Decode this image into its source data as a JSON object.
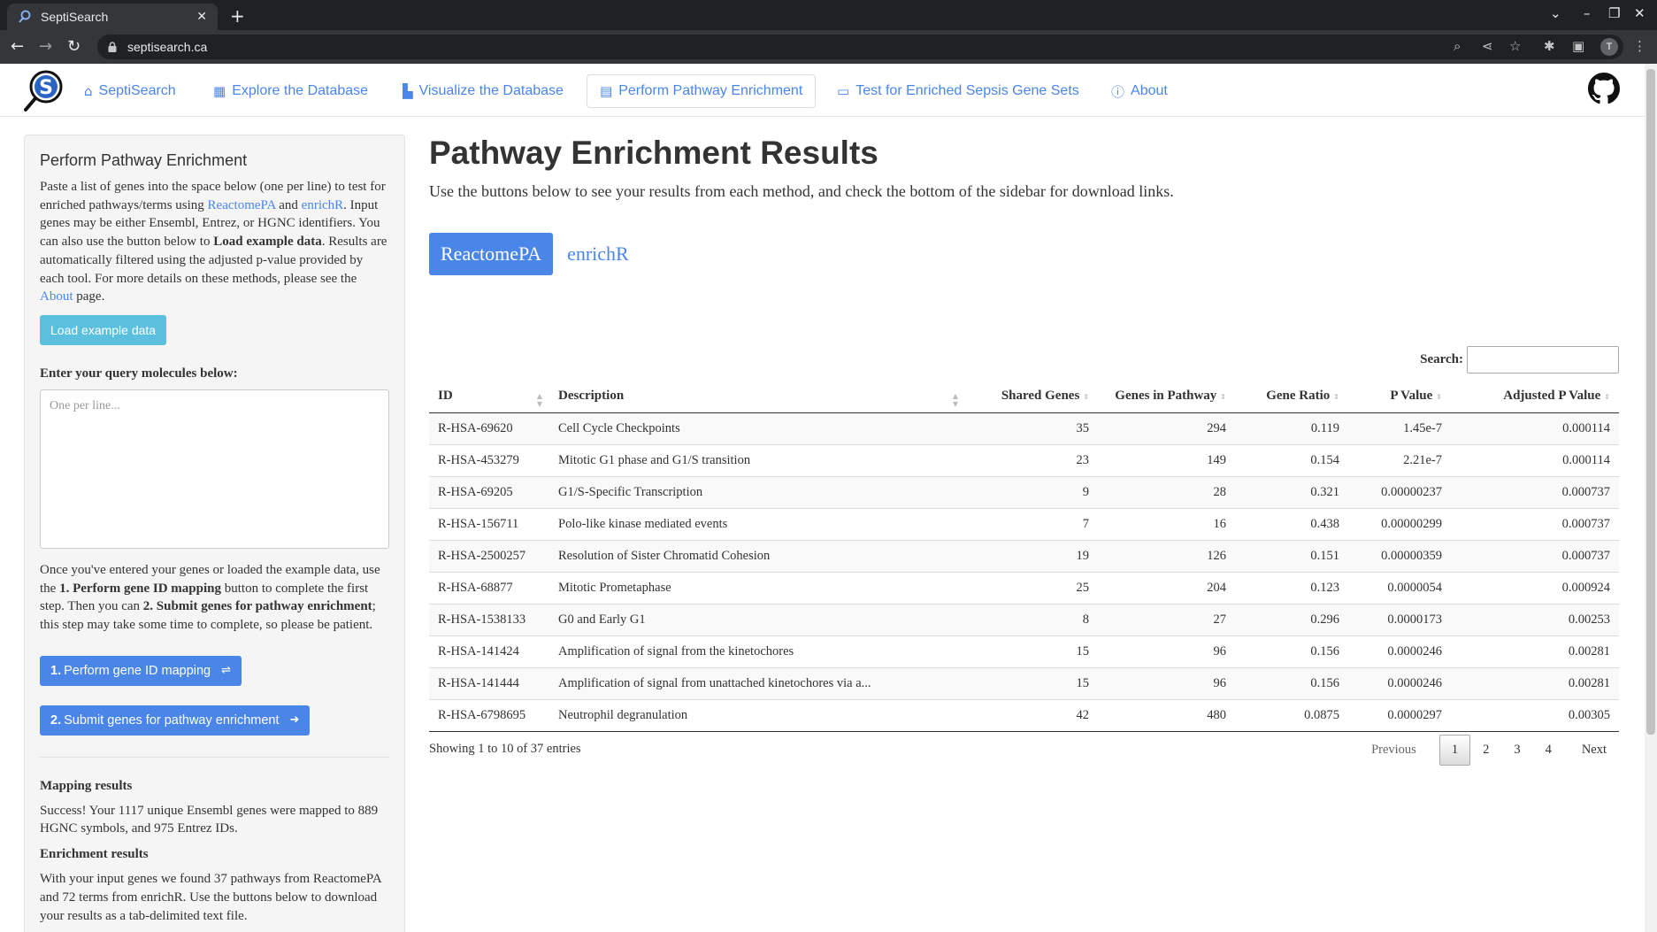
{
  "browser": {
    "tab_title": "SeptiSearch",
    "tab_close": "✕",
    "new_tab": "+",
    "url": "septisearch.ca",
    "profile_initial": "T"
  },
  "nav": {
    "items": [
      {
        "label": "SeptiSearch",
        "icon": "home-icon"
      },
      {
        "label": "Explore the Database",
        "icon": "table-icon"
      },
      {
        "label": "Visualize the Database",
        "icon": "chart-icon"
      },
      {
        "label": "Perform Pathway Enrichment",
        "icon": "calculator-icon"
      },
      {
        "label": "Test for Enriched Sepsis Gene Sets",
        "icon": "laptop-icon"
      },
      {
        "label": "About",
        "icon": "info-icon"
      }
    ],
    "active_index": 3
  },
  "sidebar": {
    "title": "Perform Pathway Enrichment",
    "intro_1": "Paste a list of genes into the space below (one per line) to test for enriched pathways/terms using ",
    "link_reactome": "ReactomePA",
    "intro_and": " and ",
    "link_enrichr": "enrichR",
    "intro_2": ". Input genes may be either Ensembl, Entrez, or HGNC identifiers. You can also use the button below to ",
    "intro_bold": "Load example data",
    "intro_3": ". Results are automatically filtered using the adjusted p-value provided by each tool. For more details on these methods, please see the ",
    "link_about": "About",
    "intro_4": " page.",
    "load_button": "Load example data",
    "query_label": "Enter your query molecules below:",
    "query_placeholder": "One per line...",
    "instr_1": "Once you've entered your genes or loaded the example data, use the ",
    "instr_bold1": "1. Perform gene ID mapping",
    "instr_2": " button to complete the first step. Then you can ",
    "instr_bold2": "2. Submit genes for pathway enrichment",
    "instr_3": "; this step may take some time to complete, so please be patient.",
    "btn1_num": "1.",
    "btn1_label": "Perform gene ID mapping",
    "btn2_num": "2.",
    "btn2_label": "Submit genes for pathway enrichment",
    "mapping_title": "Mapping results",
    "mapping_text": "Success! Your 1117 unique Ensembl genes were mapped to 889 HGNC symbols, and 975 Entrez IDs.",
    "enrich_title": "Enrichment results",
    "enrich_text": "With your input genes we found 37 pathways from ReactomePA and 72 terms from enrichR. Use the buttons below to download your results as a tab-delimited text file."
  },
  "main": {
    "title": "Pathway Enrichment Results",
    "lead": "Use the buttons below to see your results from each method, and check the bottom of the sidebar for download links.",
    "tabs": [
      "ReactomePA",
      "enrichR"
    ],
    "search_label": "Search:",
    "columns": [
      "ID",
      "Description",
      "Shared Genes",
      "Genes in Pathway",
      "Gene Ratio",
      "P Value",
      "Adjusted P Value"
    ],
    "rows": [
      [
        "R-HSA-69620",
        "Cell Cycle Checkpoints",
        "35",
        "294",
        "0.119",
        "1.45e-7",
        "0.000114"
      ],
      [
        "R-HSA-453279",
        "Mitotic G1 phase and G1/S transition",
        "23",
        "149",
        "0.154",
        "2.21e-7",
        "0.000114"
      ],
      [
        "R-HSA-69205",
        "G1/S-Specific Transcription",
        "9",
        "28",
        "0.321",
        "0.00000237",
        "0.000737"
      ],
      [
        "R-HSA-156711",
        "Polo-like kinase mediated events",
        "7",
        "16",
        "0.438",
        "0.00000299",
        "0.000737"
      ],
      [
        "R-HSA-2500257",
        "Resolution of Sister Chromatid Cohesion",
        "19",
        "126",
        "0.151",
        "0.00000359",
        "0.000737"
      ],
      [
        "R-HSA-68877",
        "Mitotic Prometaphase",
        "25",
        "204",
        "0.123",
        "0.0000054",
        "0.000924"
      ],
      [
        "R-HSA-1538133",
        "G0 and Early G1",
        "8",
        "27",
        "0.296",
        "0.0000173",
        "0.00253"
      ],
      [
        "R-HSA-141424",
        "Amplification of signal from the kinetochores",
        "15",
        "96",
        "0.156",
        "0.0000246",
        "0.00281"
      ],
      [
        "R-HSA-141444",
        "Amplification of signal from unattached kinetochores via a...",
        "15",
        "96",
        "0.156",
        "0.0000246",
        "0.00281"
      ],
      [
        "R-HSA-6798695",
        "Neutrophil degranulation",
        "42",
        "480",
        "0.0875",
        "0.0000297",
        "0.00305"
      ]
    ],
    "info": "Showing 1 to 10 of 37 entries",
    "pagination": {
      "previous": "Previous",
      "pages": [
        "1",
        "2",
        "3",
        "4"
      ],
      "next": "Next",
      "current": "1"
    }
  },
  "colors": {
    "accent": "#4a86e8",
    "info_button": "#5bc0de",
    "chrome": "#202124"
  }
}
